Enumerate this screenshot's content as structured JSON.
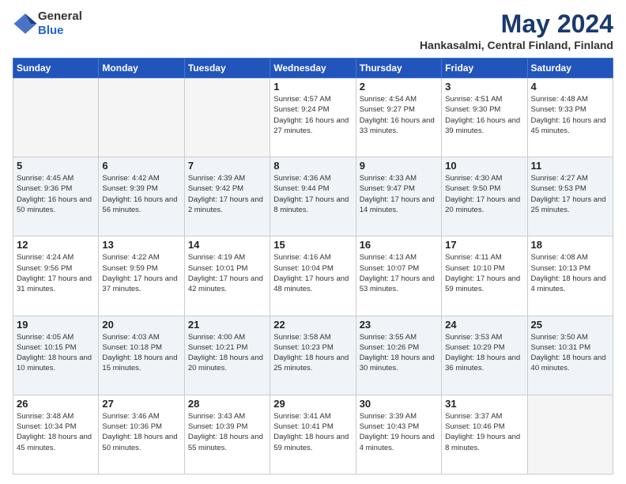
{
  "header": {
    "logo_general": "General",
    "logo_blue": "Blue",
    "title": "May 2024",
    "subtitle": "Hankasalmi, Central Finland, Finland"
  },
  "days_of_week": [
    "Sunday",
    "Monday",
    "Tuesday",
    "Wednesday",
    "Thursday",
    "Friday",
    "Saturday"
  ],
  "weeks": [
    [
      {
        "day": "",
        "empty": true
      },
      {
        "day": "",
        "empty": true
      },
      {
        "day": "",
        "empty": true
      },
      {
        "day": "1",
        "sunrise": "4:57 AM",
        "sunset": "9:24 PM",
        "daylight": "16 hours and 27 minutes."
      },
      {
        "day": "2",
        "sunrise": "4:54 AM",
        "sunset": "9:27 PM",
        "daylight": "16 hours and 33 minutes."
      },
      {
        "day": "3",
        "sunrise": "4:51 AM",
        "sunset": "9:30 PM",
        "daylight": "16 hours and 39 minutes."
      },
      {
        "day": "4",
        "sunrise": "4:48 AM",
        "sunset": "9:33 PM",
        "daylight": "16 hours and 45 minutes."
      }
    ],
    [
      {
        "day": "5",
        "sunrise": "4:45 AM",
        "sunset": "9:36 PM",
        "daylight": "16 hours and 50 minutes."
      },
      {
        "day": "6",
        "sunrise": "4:42 AM",
        "sunset": "9:39 PM",
        "daylight": "16 hours and 56 minutes."
      },
      {
        "day": "7",
        "sunrise": "4:39 AM",
        "sunset": "9:42 PM",
        "daylight": "17 hours and 2 minutes."
      },
      {
        "day": "8",
        "sunrise": "4:36 AM",
        "sunset": "9:44 PM",
        "daylight": "17 hours and 8 minutes."
      },
      {
        "day": "9",
        "sunrise": "4:33 AM",
        "sunset": "9:47 PM",
        "daylight": "17 hours and 14 minutes."
      },
      {
        "day": "10",
        "sunrise": "4:30 AM",
        "sunset": "9:50 PM",
        "daylight": "17 hours and 20 minutes."
      },
      {
        "day": "11",
        "sunrise": "4:27 AM",
        "sunset": "9:53 PM",
        "daylight": "17 hours and 25 minutes."
      }
    ],
    [
      {
        "day": "12",
        "sunrise": "4:24 AM",
        "sunset": "9:56 PM",
        "daylight": "17 hours and 31 minutes."
      },
      {
        "day": "13",
        "sunrise": "4:22 AM",
        "sunset": "9:59 PM",
        "daylight": "17 hours and 37 minutes."
      },
      {
        "day": "14",
        "sunrise": "4:19 AM",
        "sunset": "10:01 PM",
        "daylight": "17 hours and 42 minutes."
      },
      {
        "day": "15",
        "sunrise": "4:16 AM",
        "sunset": "10:04 PM",
        "daylight": "17 hours and 48 minutes."
      },
      {
        "day": "16",
        "sunrise": "4:13 AM",
        "sunset": "10:07 PM",
        "daylight": "17 hours and 53 minutes."
      },
      {
        "day": "17",
        "sunrise": "4:11 AM",
        "sunset": "10:10 PM",
        "daylight": "17 hours and 59 minutes."
      },
      {
        "day": "18",
        "sunrise": "4:08 AM",
        "sunset": "10:13 PM",
        "daylight": "18 hours and 4 minutes."
      }
    ],
    [
      {
        "day": "19",
        "sunrise": "4:05 AM",
        "sunset": "10:15 PM",
        "daylight": "18 hours and 10 minutes."
      },
      {
        "day": "20",
        "sunrise": "4:03 AM",
        "sunset": "10:18 PM",
        "daylight": "18 hours and 15 minutes."
      },
      {
        "day": "21",
        "sunrise": "4:00 AM",
        "sunset": "10:21 PM",
        "daylight": "18 hours and 20 minutes."
      },
      {
        "day": "22",
        "sunrise": "3:58 AM",
        "sunset": "10:23 PM",
        "daylight": "18 hours and 25 minutes."
      },
      {
        "day": "23",
        "sunrise": "3:55 AM",
        "sunset": "10:26 PM",
        "daylight": "18 hours and 30 minutes."
      },
      {
        "day": "24",
        "sunrise": "3:53 AM",
        "sunset": "10:29 PM",
        "daylight": "18 hours and 36 minutes."
      },
      {
        "day": "25",
        "sunrise": "3:50 AM",
        "sunset": "10:31 PM",
        "daylight": "18 hours and 40 minutes."
      }
    ],
    [
      {
        "day": "26",
        "sunrise": "3:48 AM",
        "sunset": "10:34 PM",
        "daylight": "18 hours and 45 minutes."
      },
      {
        "day": "27",
        "sunrise": "3:46 AM",
        "sunset": "10:36 PM",
        "daylight": "18 hours and 50 minutes."
      },
      {
        "day": "28",
        "sunrise": "3:43 AM",
        "sunset": "10:39 PM",
        "daylight": "18 hours and 55 minutes."
      },
      {
        "day": "29",
        "sunrise": "3:41 AM",
        "sunset": "10:41 PM",
        "daylight": "18 hours and 59 minutes."
      },
      {
        "day": "30",
        "sunrise": "3:39 AM",
        "sunset": "10:43 PM",
        "daylight": "19 hours and 4 minutes."
      },
      {
        "day": "31",
        "sunrise": "3:37 AM",
        "sunset": "10:46 PM",
        "daylight": "19 hours and 8 minutes."
      },
      {
        "day": "",
        "empty": true
      }
    ]
  ]
}
